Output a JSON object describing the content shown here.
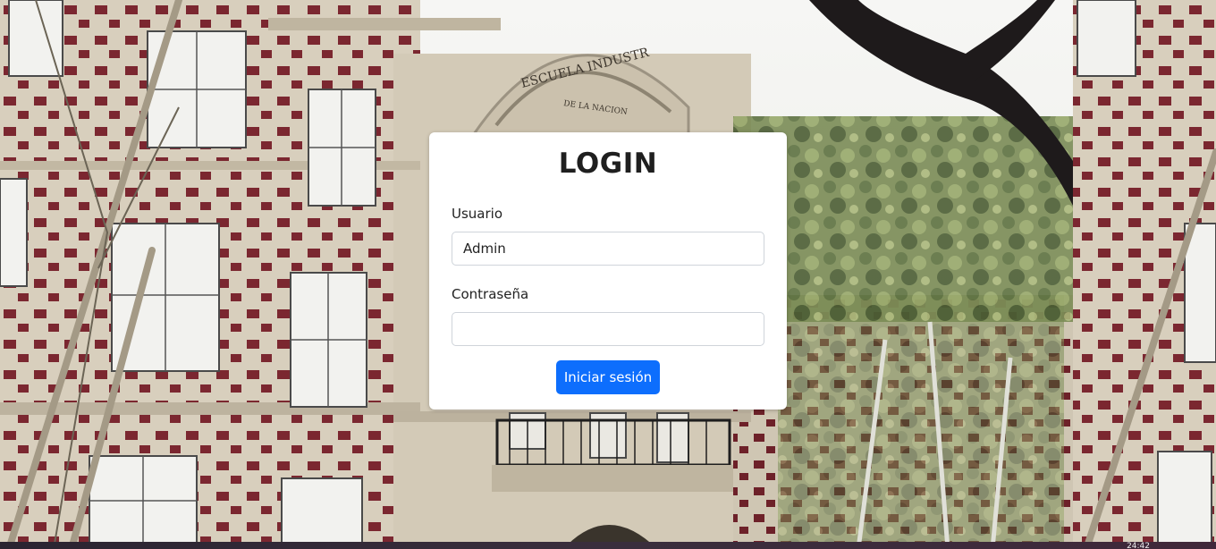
{
  "login": {
    "title": "LOGIN",
    "username_label": "Usuario",
    "username_value": "Admin",
    "password_label": "Contraseña",
    "password_value": "",
    "submit_label": "Iniciar sesión"
  },
  "background": {
    "building_sign": "ESCUELA INDUSTRIAL DE LA NACION"
  },
  "taskbar": {
    "clock": "24:42"
  },
  "colors": {
    "primary": "#0d6efd",
    "card": "#ffffff",
    "facade": "#d6cdb9",
    "brick": "#7b2730"
  }
}
